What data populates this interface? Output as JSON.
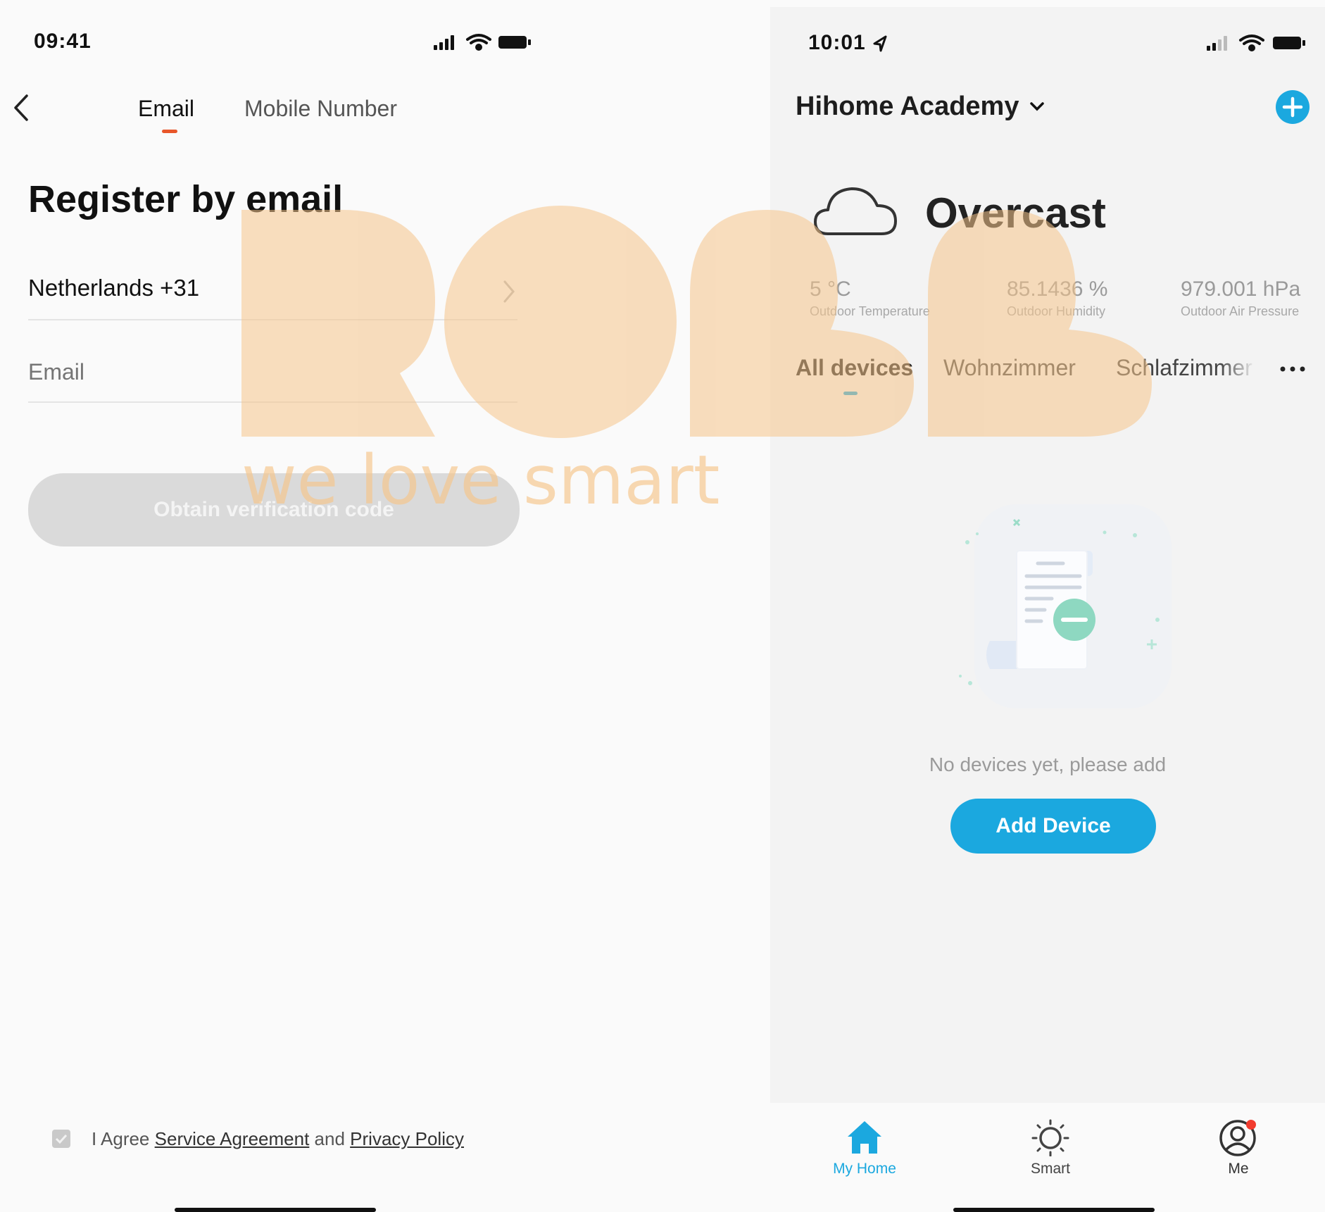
{
  "left": {
    "status_time": "09:41",
    "tabs": [
      "Email",
      "Mobile Number"
    ],
    "title": "Register by email",
    "country": "Netherlands +31",
    "email_placeholder": "Email",
    "obtain_button": "Obtain verification code",
    "agree_prefix": "I Agree",
    "service_agreement": "Service Agreement",
    "and": "and",
    "privacy_policy": "Privacy Policy"
  },
  "right": {
    "status_time": "10:01",
    "home_name": "Hihome Academy",
    "weather": {
      "condition": "Overcast",
      "stats": [
        {
          "value": "5 °C",
          "label": "Outdoor Temperature"
        },
        {
          "value": "85.1436 %",
          "label": "Outdoor Humidity"
        },
        {
          "value": "979.001 hPa",
          "label": "Outdoor Air Pressure"
        }
      ]
    },
    "rooms": [
      "All devices",
      "Wohnzimmer",
      "Schlafzimmer"
    ],
    "empty_text": "No devices yet, please add",
    "add_button": "Add Device",
    "nav": [
      "My Home",
      "Smart",
      "Me"
    ]
  },
  "watermark": {
    "text": "we love smart"
  },
  "colors": {
    "accent": "#1ba8df",
    "tab_indicator_left": "#e8562a",
    "tab_indicator_right": "#1ba8df",
    "watermark": "#f6c58a",
    "notification": "#f23b2e"
  }
}
